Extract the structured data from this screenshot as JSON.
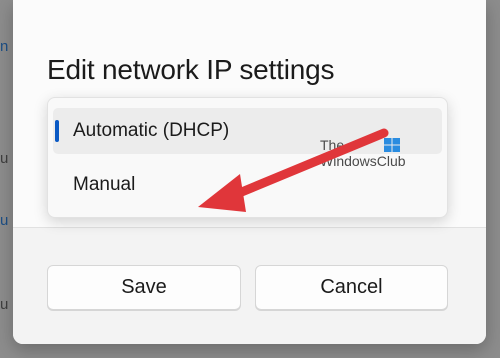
{
  "dialog": {
    "title": "Edit network IP settings",
    "dropdown": {
      "options": [
        {
          "label": "Automatic (DHCP)",
          "selected": true
        },
        {
          "label": "Manual",
          "selected": false
        }
      ]
    },
    "buttons": {
      "save_label": "Save",
      "cancel_label": "Cancel"
    }
  },
  "watermark": {
    "line1": "The",
    "line2": "WindowsClub"
  },
  "background_peek": [
    "n",
    "u",
    "u",
    "u"
  ],
  "colors": {
    "accent": "#0a59c4",
    "arrow": "#e0363a",
    "overlay": "#8d8d8d"
  }
}
